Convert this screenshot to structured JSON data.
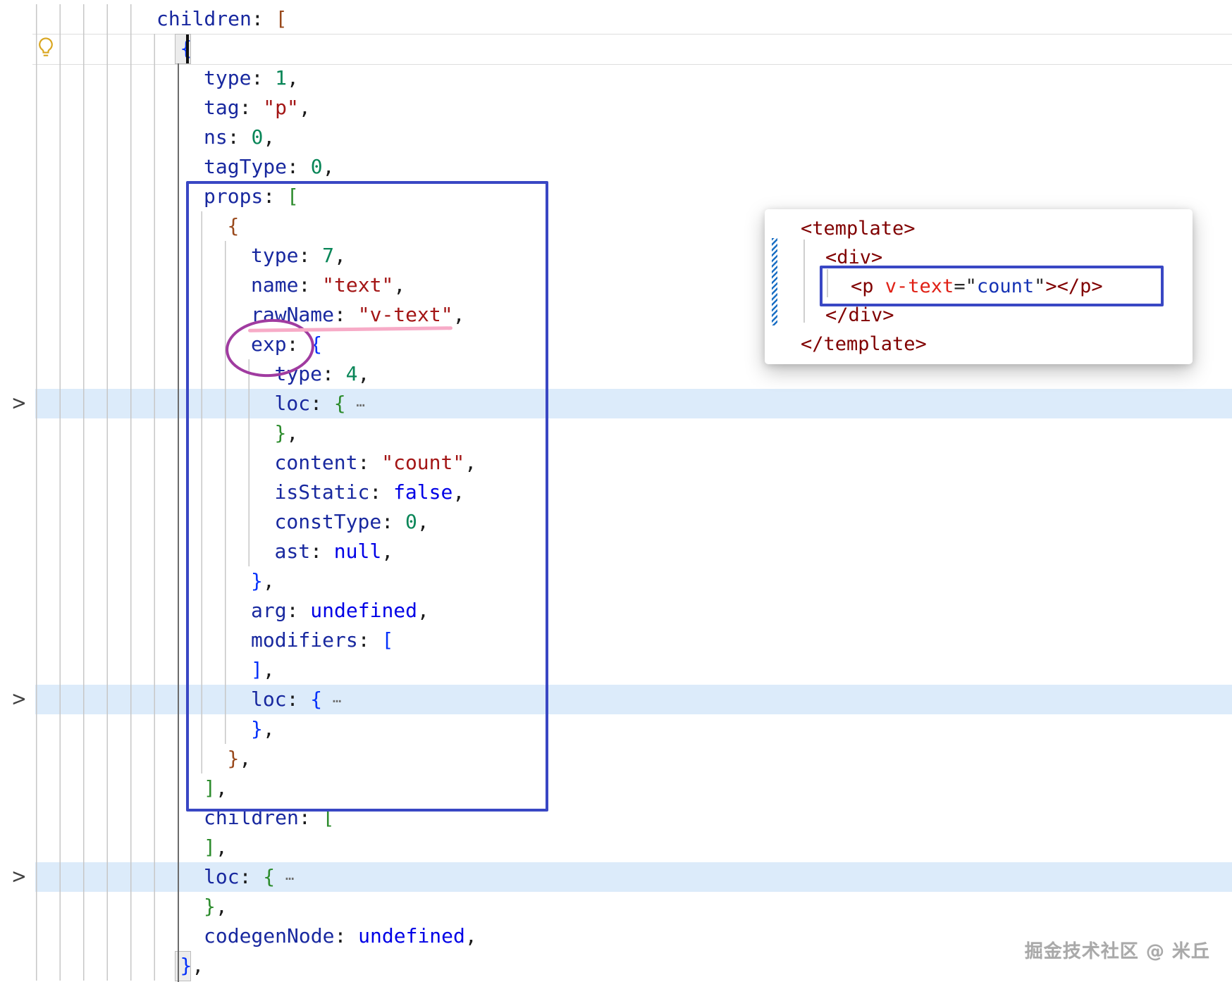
{
  "colors": {
    "band_highlight": "#DCEBFA",
    "indent_guide": "#C7C7C7",
    "active_indent_guide": "#6B6B6B",
    "annotation_blue": "#3947C4",
    "annotation_purple": "#A03BA0",
    "annotation_pink": "#F7ABC7",
    "diff_modified_blue": "#1A6FC4",
    "key": "#18289F",
    "number": "#098658",
    "string": "#A31515",
    "keyword": "#0000E6",
    "bracket_blue": "#0431FA",
    "bracket_green": "#2D8C2D",
    "bracket_brown": "#99491C",
    "tag": "#800000",
    "attr_name": "#E02015",
    "attr_value": "#1633B4"
  },
  "editor": {
    "fold_chevron": ">",
    "folded_ellipsis": "⋯",
    "lines": [
      {
        "lvl": 0,
        "tk": [
          {
            "t": "children",
            "c": "key"
          },
          {
            "t": ": ",
            "c": "pn"
          },
          {
            "t": "[",
            "c": "bn"
          }
        ]
      },
      {
        "lvl": 1,
        "tk": [
          {
            "t": "{",
            "c": "bb"
          }
        ],
        "boxed": true,
        "cursor": true
      },
      {
        "lvl": 2,
        "tk": [
          {
            "t": "type",
            "c": "key"
          },
          {
            "t": ": ",
            "c": "pn"
          },
          {
            "t": "1",
            "c": "num"
          },
          {
            "t": ",",
            "c": "pn"
          }
        ]
      },
      {
        "lvl": 2,
        "tk": [
          {
            "t": "tag",
            "c": "key"
          },
          {
            "t": ": ",
            "c": "pn"
          },
          {
            "t": "\"p\"",
            "c": "str"
          },
          {
            "t": ",",
            "c": "pn"
          }
        ]
      },
      {
        "lvl": 2,
        "tk": [
          {
            "t": "ns",
            "c": "key"
          },
          {
            "t": ": ",
            "c": "pn"
          },
          {
            "t": "0",
            "c": "num"
          },
          {
            "t": ",",
            "c": "pn"
          }
        ]
      },
      {
        "lvl": 2,
        "tk": [
          {
            "t": "tagType",
            "c": "key"
          },
          {
            "t": ": ",
            "c": "pn"
          },
          {
            "t": "0",
            "c": "num"
          },
          {
            "t": ",",
            "c": "pn"
          }
        ]
      },
      {
        "lvl": 2,
        "tk": [
          {
            "t": "props",
            "c": "key"
          },
          {
            "t": ": ",
            "c": "pn"
          },
          {
            "t": "[",
            "c": "bg"
          }
        ]
      },
      {
        "lvl": 3,
        "tk": [
          {
            "t": "{",
            "c": "bn"
          }
        ]
      },
      {
        "lvl": 4,
        "tk": [
          {
            "t": "type",
            "c": "key"
          },
          {
            "t": ": ",
            "c": "pn"
          },
          {
            "t": "7",
            "c": "num"
          },
          {
            "t": ",",
            "c": "pn"
          }
        ]
      },
      {
        "lvl": 4,
        "tk": [
          {
            "t": "name",
            "c": "key"
          },
          {
            "t": ": ",
            "c": "pn"
          },
          {
            "t": "\"text\"",
            "c": "str"
          },
          {
            "t": ",",
            "c": "pn"
          }
        ]
      },
      {
        "lvl": 4,
        "tk": [
          {
            "t": "rawName",
            "c": "key"
          },
          {
            "t": ": ",
            "c": "pn"
          },
          {
            "t": "\"v-text\"",
            "c": "str"
          },
          {
            "t": ",",
            "c": "pn"
          }
        ]
      },
      {
        "lvl": 4,
        "tk": [
          {
            "t": "exp",
            "c": "key"
          },
          {
            "t": ": ",
            "c": "pn"
          },
          {
            "t": "{",
            "c": "bb"
          }
        ]
      },
      {
        "lvl": 5,
        "tk": [
          {
            "t": "type",
            "c": "key"
          },
          {
            "t": ": ",
            "c": "pn"
          },
          {
            "t": "4",
            "c": "num"
          },
          {
            "t": ",",
            "c": "pn"
          }
        ]
      },
      {
        "lvl": 5,
        "tk": [
          {
            "t": "loc",
            "c": "key"
          },
          {
            "t": ": ",
            "c": "pn"
          },
          {
            "t": "{",
            "c": "bg"
          },
          {
            "t": " ⋯",
            "c": "fold"
          }
        ],
        "hl": true,
        "chev": true
      },
      {
        "lvl": 5,
        "tk": [
          {
            "t": "}",
            "c": "bg"
          },
          {
            "t": ",",
            "c": "pn"
          }
        ]
      },
      {
        "lvl": 5,
        "tk": [
          {
            "t": "content",
            "c": "key"
          },
          {
            "t": ": ",
            "c": "pn"
          },
          {
            "t": "\"count\"",
            "c": "str"
          },
          {
            "t": ",",
            "c": "pn"
          }
        ]
      },
      {
        "lvl": 5,
        "tk": [
          {
            "t": "isStatic",
            "c": "key"
          },
          {
            "t": ": ",
            "c": "pn"
          },
          {
            "t": "false",
            "c": "kw"
          },
          {
            "t": ",",
            "c": "pn"
          }
        ]
      },
      {
        "lvl": 5,
        "tk": [
          {
            "t": "constType",
            "c": "key"
          },
          {
            "t": ": ",
            "c": "pn"
          },
          {
            "t": "0",
            "c": "num"
          },
          {
            "t": ",",
            "c": "pn"
          }
        ]
      },
      {
        "lvl": 5,
        "tk": [
          {
            "t": "ast",
            "c": "key"
          },
          {
            "t": ": ",
            "c": "pn"
          },
          {
            "t": "null",
            "c": "kw"
          },
          {
            "t": ",",
            "c": "pn"
          }
        ]
      },
      {
        "lvl": 4,
        "tk": [
          {
            "t": "}",
            "c": "bb"
          },
          {
            "t": ",",
            "c": "pn"
          }
        ]
      },
      {
        "lvl": 4,
        "tk": [
          {
            "t": "arg",
            "c": "key"
          },
          {
            "t": ": ",
            "c": "pn"
          },
          {
            "t": "undefined",
            "c": "kw"
          },
          {
            "t": ",",
            "c": "pn"
          }
        ]
      },
      {
        "lvl": 4,
        "tk": [
          {
            "t": "modifiers",
            "c": "key"
          },
          {
            "t": ": ",
            "c": "pn"
          },
          {
            "t": "[",
            "c": "bb"
          }
        ]
      },
      {
        "lvl": 4,
        "tk": [
          {
            "t": "]",
            "c": "bb"
          },
          {
            "t": ",",
            "c": "pn"
          }
        ]
      },
      {
        "lvl": 4,
        "tk": [
          {
            "t": "loc",
            "c": "key"
          },
          {
            "t": ": ",
            "c": "pn"
          },
          {
            "t": "{",
            "c": "bb"
          },
          {
            "t": " ⋯",
            "c": "fold"
          }
        ],
        "hl": true,
        "chev": true
      },
      {
        "lvl": 4,
        "tk": [
          {
            "t": "}",
            "c": "bb"
          },
          {
            "t": ",",
            "c": "pn"
          }
        ]
      },
      {
        "lvl": 3,
        "tk": [
          {
            "t": "}",
            "c": "bn"
          },
          {
            "t": ",",
            "c": "pn"
          }
        ]
      },
      {
        "lvl": 2,
        "tk": [
          {
            "t": "]",
            "c": "bg"
          },
          {
            "t": ",",
            "c": "pn"
          }
        ]
      },
      {
        "lvl": 2,
        "tk": [
          {
            "t": "children",
            "c": "key"
          },
          {
            "t": ": ",
            "c": "pn"
          },
          {
            "t": "[",
            "c": "bg"
          }
        ]
      },
      {
        "lvl": 2,
        "tk": [
          {
            "t": "]",
            "c": "bg"
          },
          {
            "t": ",",
            "c": "pn"
          }
        ]
      },
      {
        "lvl": 2,
        "tk": [
          {
            "t": "loc",
            "c": "key"
          },
          {
            "t": ": ",
            "c": "pn"
          },
          {
            "t": "{",
            "c": "bg"
          },
          {
            "t": " ⋯",
            "c": "fold"
          }
        ],
        "hl": true,
        "chev": true
      },
      {
        "lvl": 2,
        "tk": [
          {
            "t": "}",
            "c": "bg"
          },
          {
            "t": ",",
            "c": "pn"
          }
        ]
      },
      {
        "lvl": 2,
        "tk": [
          {
            "t": "codegenNode",
            "c": "key"
          },
          {
            "t": ": ",
            "c": "pn"
          },
          {
            "t": "undefined",
            "c": "kw"
          },
          {
            "t": ",",
            "c": "pn"
          }
        ]
      },
      {
        "lvl": 1,
        "tk": [
          {
            "t": "}",
            "c": "bb"
          },
          {
            "t": ",",
            "c": "pn"
          }
        ],
        "boxed": true
      }
    ]
  },
  "card": {
    "lines": [
      {
        "ind": 51,
        "tk": [
          {
            "t": "<template>",
            "c": "tag"
          }
        ]
      },
      {
        "ind": 86,
        "tk": [
          {
            "t": "<div>",
            "c": "tag"
          }
        ]
      },
      {
        "ind": 122,
        "tk": [
          {
            "t": "<p ",
            "c": "tag"
          },
          {
            "t": "v-text",
            "c": "attr"
          },
          {
            "t": "=",
            "c": "eq"
          },
          {
            "t": "\"",
            "c": "eq"
          },
          {
            "t": "count",
            "c": "val"
          },
          {
            "t": "\"",
            "c": "eq"
          },
          {
            "t": "></p>",
            "c": "tag"
          }
        ]
      },
      {
        "ind": 86,
        "tk": [
          {
            "t": "</div>",
            "c": "tag"
          }
        ]
      },
      {
        "ind": 51,
        "tk": [
          {
            "t": "</template>",
            "c": "tag"
          }
        ]
      }
    ]
  },
  "watermark": {
    "text": "掘金技术社区 @ 米丘"
  }
}
